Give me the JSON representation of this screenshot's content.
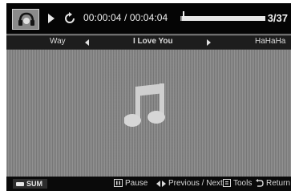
{
  "player": {
    "elapsed_time": "00:00:04",
    "total_time": "00:04:04",
    "time_display": "00:00:04 / 00:04:04",
    "track_counter": "3/37",
    "progress_fraction": 0.016
  },
  "playlist": {
    "previous_track": "Way",
    "current_track": "I Love You",
    "next_track": "HaHaHa"
  },
  "bottom_bar": {
    "sum_label": "SUM",
    "pause_label": "Pause",
    "prev_next_label": "Previous / Next",
    "tools_label": "Tools",
    "return_label": "Return"
  },
  "icons": {
    "badge": "music-headphones-icon",
    "play": "play-icon",
    "repeat": "repeat-icon",
    "main": "music-note-icon"
  },
  "colors": {
    "bar_background": "#050505",
    "main_background": "#858585",
    "progress_track": "#e8e8e8"
  }
}
